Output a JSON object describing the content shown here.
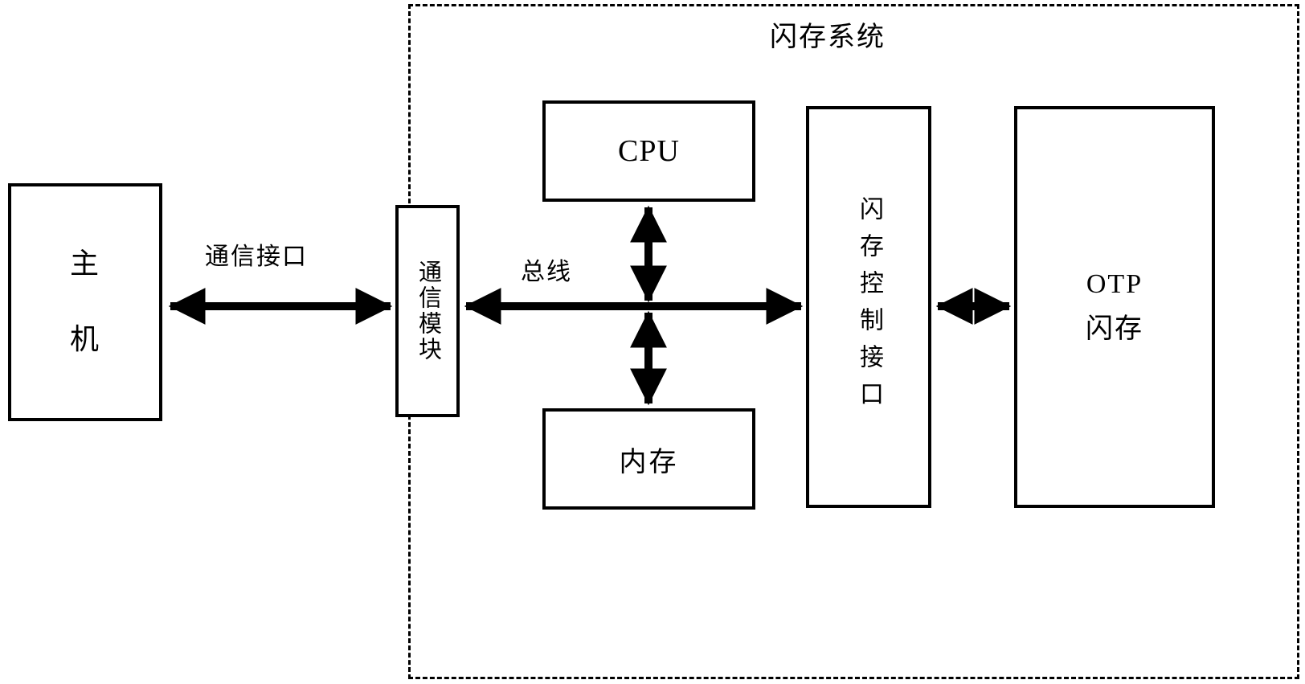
{
  "diagram": {
    "title": "闪存系统",
    "boundary_style": "dashed",
    "boxes": {
      "host": "主机",
      "comm_module": "通信模块",
      "cpu": "CPU",
      "memory": "内存",
      "flash_control_interface": "闪存控制接口",
      "otp_flash_line1": "OTP",
      "otp_flash_line2": "闪存"
    },
    "edge_labels": {
      "comm_interface": "通信接口",
      "bus": "总线"
    },
    "connections": [
      {
        "from": "主机",
        "to": "通信模块",
        "label": "通信接口",
        "arrow": "double",
        "orientation": "horizontal"
      },
      {
        "from": "通信模块",
        "to": "闪存控制接口",
        "label": "总线",
        "arrow": "double",
        "orientation": "horizontal"
      },
      {
        "from": "CPU",
        "to": "总线",
        "label": "",
        "arrow": "double",
        "orientation": "vertical"
      },
      {
        "from": "总线",
        "to": "内存",
        "label": "",
        "arrow": "double",
        "orientation": "vertical"
      },
      {
        "from": "闪存控制接口",
        "to": "OTP 闪存",
        "label": "",
        "arrow": "double",
        "orientation": "horizontal"
      }
    ],
    "colors": {
      "stroke": "#000000",
      "background": "#ffffff"
    }
  }
}
